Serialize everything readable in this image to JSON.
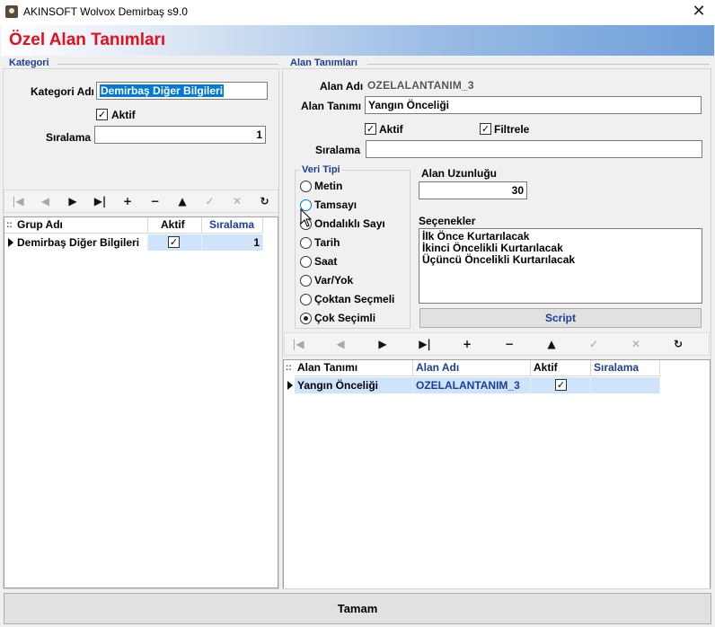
{
  "window": {
    "title": "AKINSOFT Wolvox Demirbaş s9.0",
    "close_glyph": "✕"
  },
  "header": {
    "title": "Özel Alan Tanımları"
  },
  "kategori": {
    "group_title": "Kategori",
    "name_label": "Kategori Adı",
    "name_value": "Demirbaş Diğer Bilgileri",
    "aktif_label": "Aktif",
    "aktif_checked": true,
    "order_label": "Sıralama",
    "order_value": "1",
    "grid": {
      "headers": [
        "Grup Adı",
        "Aktif",
        "Sıralama"
      ],
      "rows": [
        {
          "name": "Demirbaş Diğer Bilgileri",
          "aktif": true,
          "order": "1"
        }
      ]
    }
  },
  "alan": {
    "group_title": "Alan Tanımları",
    "adi_label": "Alan Adı",
    "adi_value": "OZELALANTANIM_3",
    "tanimi_label": "Alan Tanımı",
    "tanimi_value": "Yangın Önceliği",
    "aktif_label": "Aktif",
    "aktif_checked": true,
    "filtrele_label": "Filtrele",
    "filtrele_checked": true,
    "order_label": "Sıralama",
    "order_value": "",
    "veri_tipi_title": "Veri Tipi",
    "veri_tipi_options": [
      "Metin",
      "Tamsayı",
      "Ondalıklı Sayı",
      "Tarih",
      "Saat",
      "Var/Yok",
      "Çoktan Seçmeli",
      "Çok Seçimli"
    ],
    "veri_tipi_selected": "Çok Seçimli",
    "uzunluk_label": "Alan Uzunluğu",
    "uzunluk_value": "30",
    "secenekler_label": "Seçenekler",
    "secenekler": [
      "İlk Önce Kurtarılacak",
      "İkinci Öncelikli Kurtarılacak",
      "Üçüncü Öncelikli Kurtarılacak"
    ],
    "script_label": "Script",
    "grid": {
      "headers": [
        "Alan Tanımı",
        "Alan Adı",
        "Aktif",
        "Sıralama"
      ],
      "rows": [
        {
          "tanim": "Yangın Önceliği",
          "adi": "OZELALANTANIM_3",
          "aktif": true,
          "order": ""
        }
      ]
    }
  },
  "navigator": {
    "buttons": [
      {
        "icon": "first-record-icon",
        "glyph": "|◀",
        "enabled": false
      },
      {
        "icon": "prior-record-icon",
        "glyph": "◀",
        "enabled": false
      },
      {
        "icon": "next-record-icon",
        "glyph": "▶",
        "enabled": true
      },
      {
        "icon": "last-record-icon",
        "glyph": "▶|",
        "enabled": true
      },
      {
        "icon": "insert-record-icon",
        "glyph": "+",
        "enabled": true
      },
      {
        "icon": "delete-record-icon",
        "glyph": "−",
        "enabled": true
      },
      {
        "icon": "edit-record-icon",
        "glyph": "▲",
        "enabled": true
      },
      {
        "icon": "post-record-icon",
        "glyph": "✓",
        "enabled": false
      },
      {
        "icon": "cancel-record-icon",
        "glyph": "✕",
        "enabled": false
      },
      {
        "icon": "refresh-icon",
        "glyph": "↻",
        "enabled": true
      }
    ]
  },
  "footer": {
    "ok_label": "Tamam"
  },
  "colors": {
    "title_red": "#e4101c",
    "group_blue": "#1c3f94",
    "selection_blue": "#0078d7",
    "row_highlight": "#cfe3fa"
  }
}
